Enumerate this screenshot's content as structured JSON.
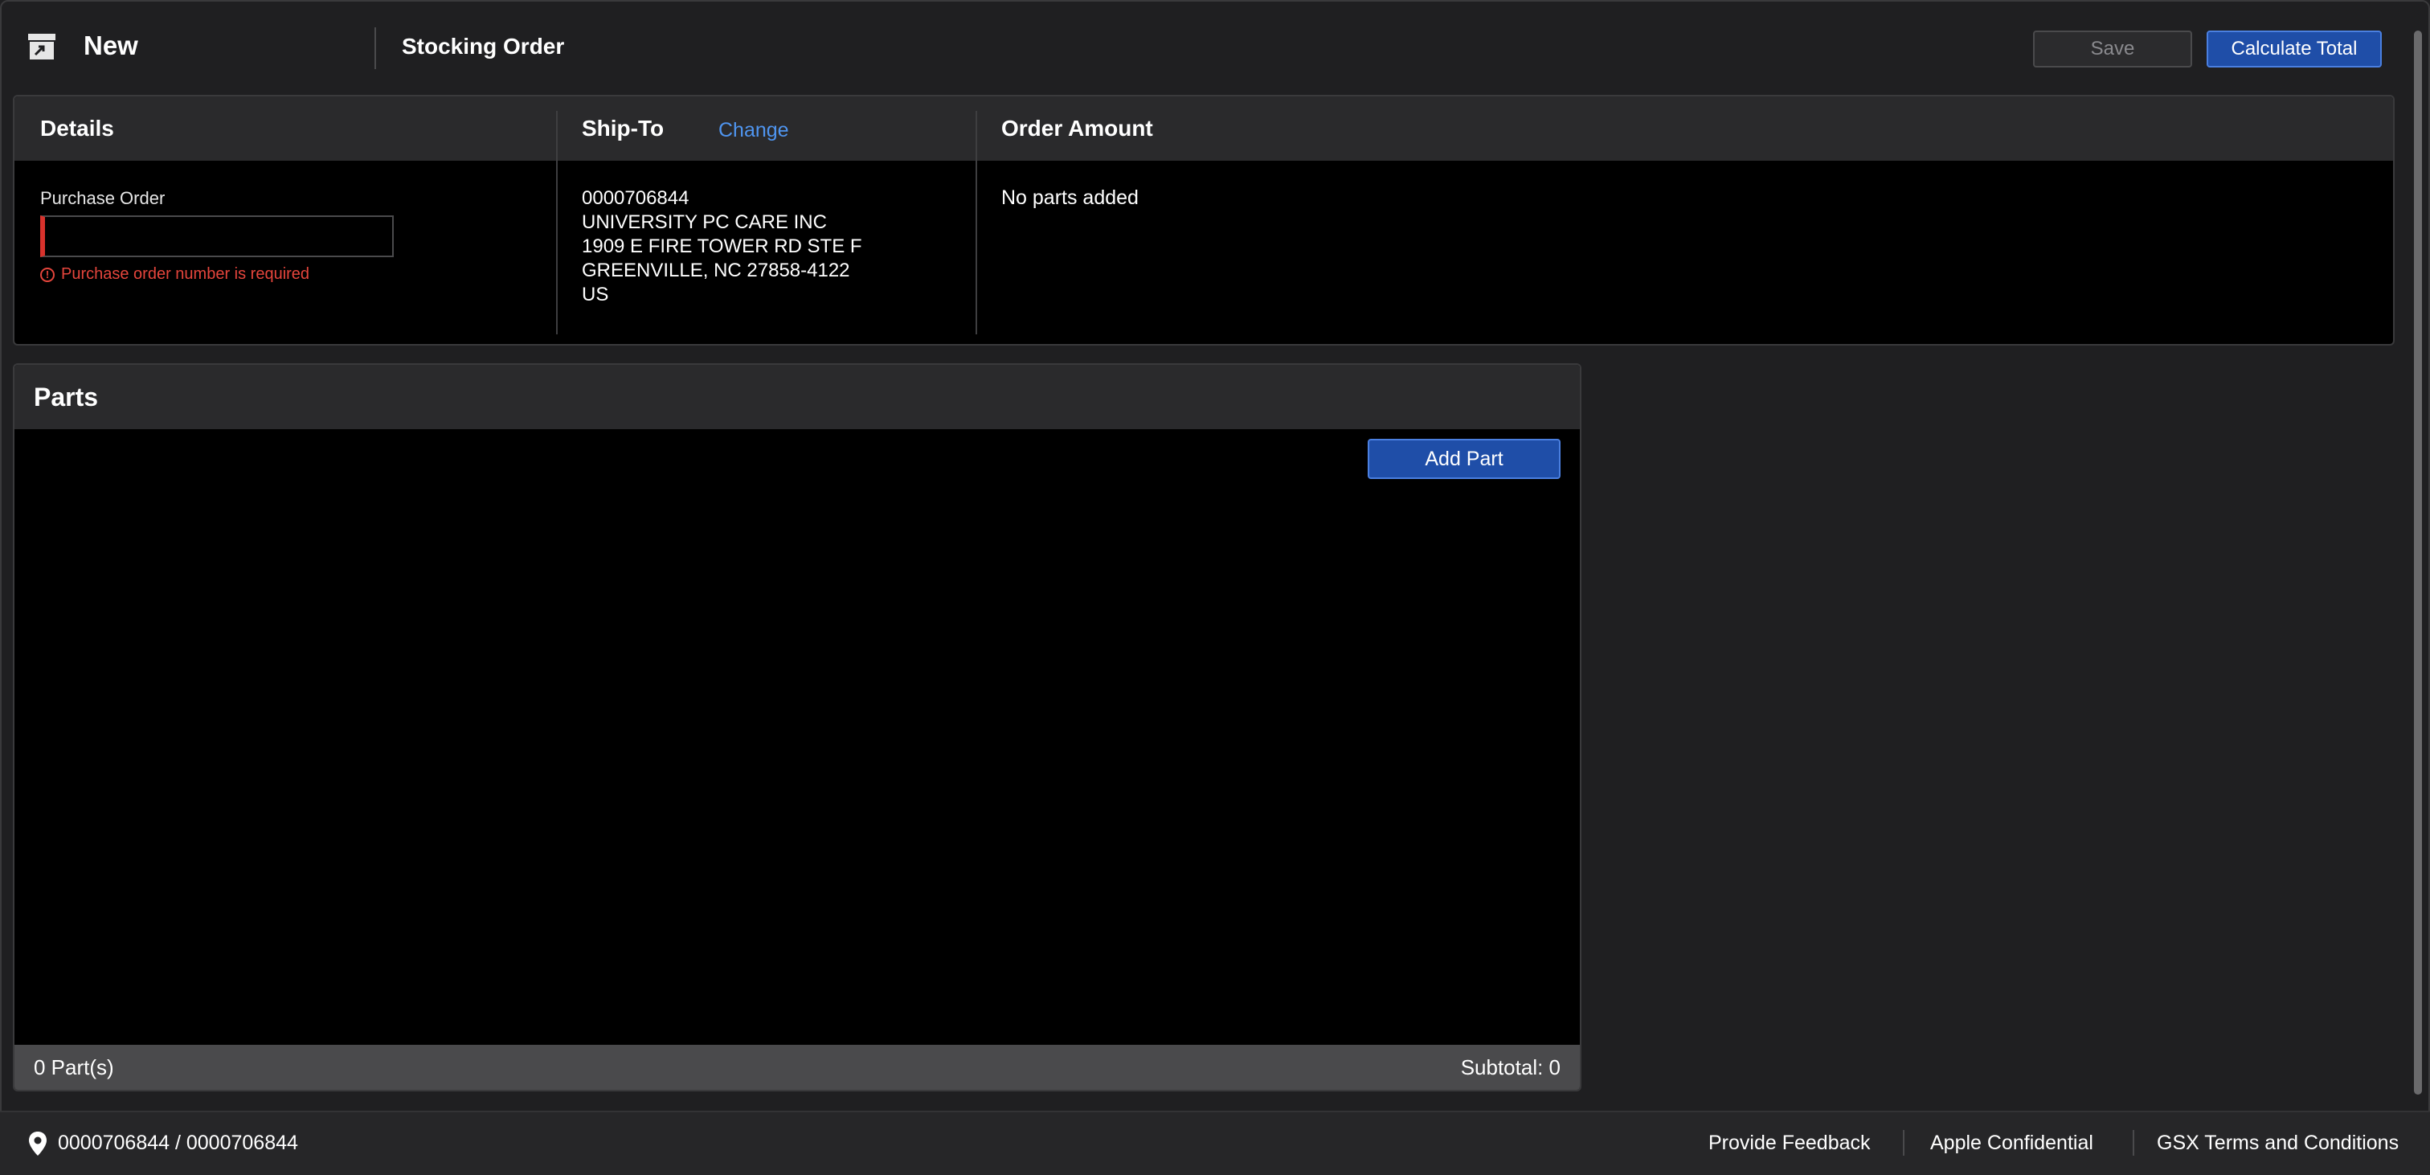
{
  "header": {
    "app_icon": "archive-box-icon",
    "new_label": "New",
    "title": "Stocking Order",
    "save_label": "Save",
    "calculate_label": "Calculate Total"
  },
  "details": {
    "title": "Details",
    "po_label": "Purchase Order",
    "po_value": "",
    "po_error": "Purchase order number is required",
    "error_icon": "!"
  },
  "ship_to": {
    "title": "Ship-To",
    "change_label": "Change",
    "address_lines": [
      "0000706844",
      "UNIVERSITY PC CARE INC",
      "1909 E FIRE TOWER RD STE F",
      "GREENVILLE, NC 27858-4122",
      "US"
    ]
  },
  "order_amount": {
    "title": "Order Amount",
    "message": "No parts added"
  },
  "parts": {
    "title": "Parts",
    "add_label": "Add Part",
    "count_text": "0 Part(s)",
    "subtotal_text": "Subtotal: 0"
  },
  "footer": {
    "location_icon": "location-pin-icon",
    "location_text": "0000706844 / 0000706844",
    "links": [
      "Provide Feedback",
      "Apple Confidential",
      "GSX Terms and Conditions"
    ]
  },
  "colors": {
    "accent": "#1f4ea8",
    "link": "#4f95f0",
    "error": "#e5453c",
    "background": "#1f1f21"
  }
}
